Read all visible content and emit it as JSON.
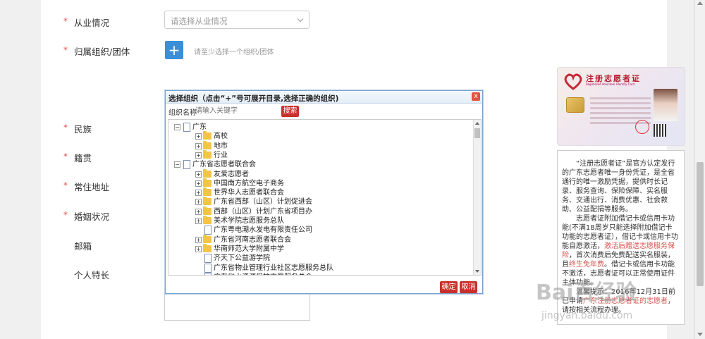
{
  "form": {
    "occupation": {
      "label": "从业情况",
      "placeholder": "请选择从业情况"
    },
    "organization": {
      "label": "归属组织/团体",
      "add_symbol": "+",
      "hint": "请至少选择一个组织/团体"
    },
    "ethnicity": {
      "label": "民族"
    },
    "native_place": {
      "label": "籍贯"
    },
    "residence": {
      "label": "常住地址"
    },
    "marital": {
      "label": "婚姻状况"
    },
    "email": {
      "label": "邮箱"
    },
    "specialty": {
      "label": "个人特长"
    },
    "required_mark": "*"
  },
  "dialog": {
    "title": "选择组织（点击“+”号可展开目录,选择正确的组织)",
    "close_symbol": "x",
    "search_label": "组织名称",
    "search_placeholder": "请输入关键字",
    "search_button": "搜索",
    "confirm_button": "确定",
    "cancel_button": "取消",
    "tree": [
      {
        "label": "广东",
        "toggle": "−",
        "type": "doc"
      },
      {
        "label": "高校",
        "toggle": "+",
        "type": "folder"
      },
      {
        "label": "地市",
        "toggle": "+",
        "type": "folder"
      },
      {
        "label": "行业",
        "toggle": "+",
        "type": "folder"
      },
      {
        "label": "广东省志愿者联合会",
        "toggle": "−",
        "type": "doc"
      },
      {
        "label": "友爱志愿者",
        "toggle": "+",
        "type": "folder"
      },
      {
        "label": "中国南方航空电子商务",
        "toggle": "+",
        "type": "folder"
      },
      {
        "label": "世界华人志愿者联合会",
        "toggle": "+",
        "type": "folder"
      },
      {
        "label": "广东省西部（山区）计划促进会",
        "toggle": "+",
        "type": "folder"
      },
      {
        "label": "西部（山区）计划广东省项目办",
        "toggle": "+",
        "type": "folder"
      },
      {
        "label": "美术学院志愿服务总队",
        "toggle": "+",
        "type": "folder"
      },
      {
        "label": "广东粤电潮水发电有限责任公司",
        "toggle": "",
        "type": "doc"
      },
      {
        "label": "广东省河南志愿者联合会",
        "toggle": "+",
        "type": "folder"
      },
      {
        "label": "华南师范大学附属中学",
        "toggle": "+",
        "type": "folder"
      },
      {
        "label": "齐天下公益游学院",
        "toggle": "",
        "type": "doc"
      },
      {
        "label": "广东省物业管理行业社区志愿服务总队",
        "toggle": "",
        "type": "doc"
      },
      {
        "label": "广东省水资源保护志愿服务总会",
        "toggle": "",
        "type": "doc"
      }
    ]
  },
  "card": {
    "title": "注册志愿者证",
    "subtitle": "Registered Volunteer Identity Card"
  },
  "description": {
    "p1": "“注册志愿者证”是官方认定发行的广东志愿者唯一身份凭证，是全省通行的唯一激励凭据，提供时长记录、服务查询、保险保障、实名服务、交通出行、消费优惠、社会救助、公益配捐等服务。",
    "p2_a": "志愿者证附加借记卡或信用卡功能(不满18周岁只能选择附加借记卡功能的志愿者证），借记卡或信用卡功能自愿激活，",
    "p2_red1": "激活后赠送志愿服务保险",
    "p2_b": "，首次消费后免费配送实名服装，且",
    "p2_red2": "终生免年费",
    "p2_c": "。借记卡或信用卡功能不激活，志愿者证可以正常使用证件主体功能。",
    "p3_a": "温馨提示：2016年12月31日前已申请",
    "p3_red": "广东注册志愿者证的志愿者",
    "p3_b": "，请按相关流程办理。"
  },
  "watermark": {
    "main": "Bai百经验",
    "sub": "jingyan.baidu.com"
  }
}
